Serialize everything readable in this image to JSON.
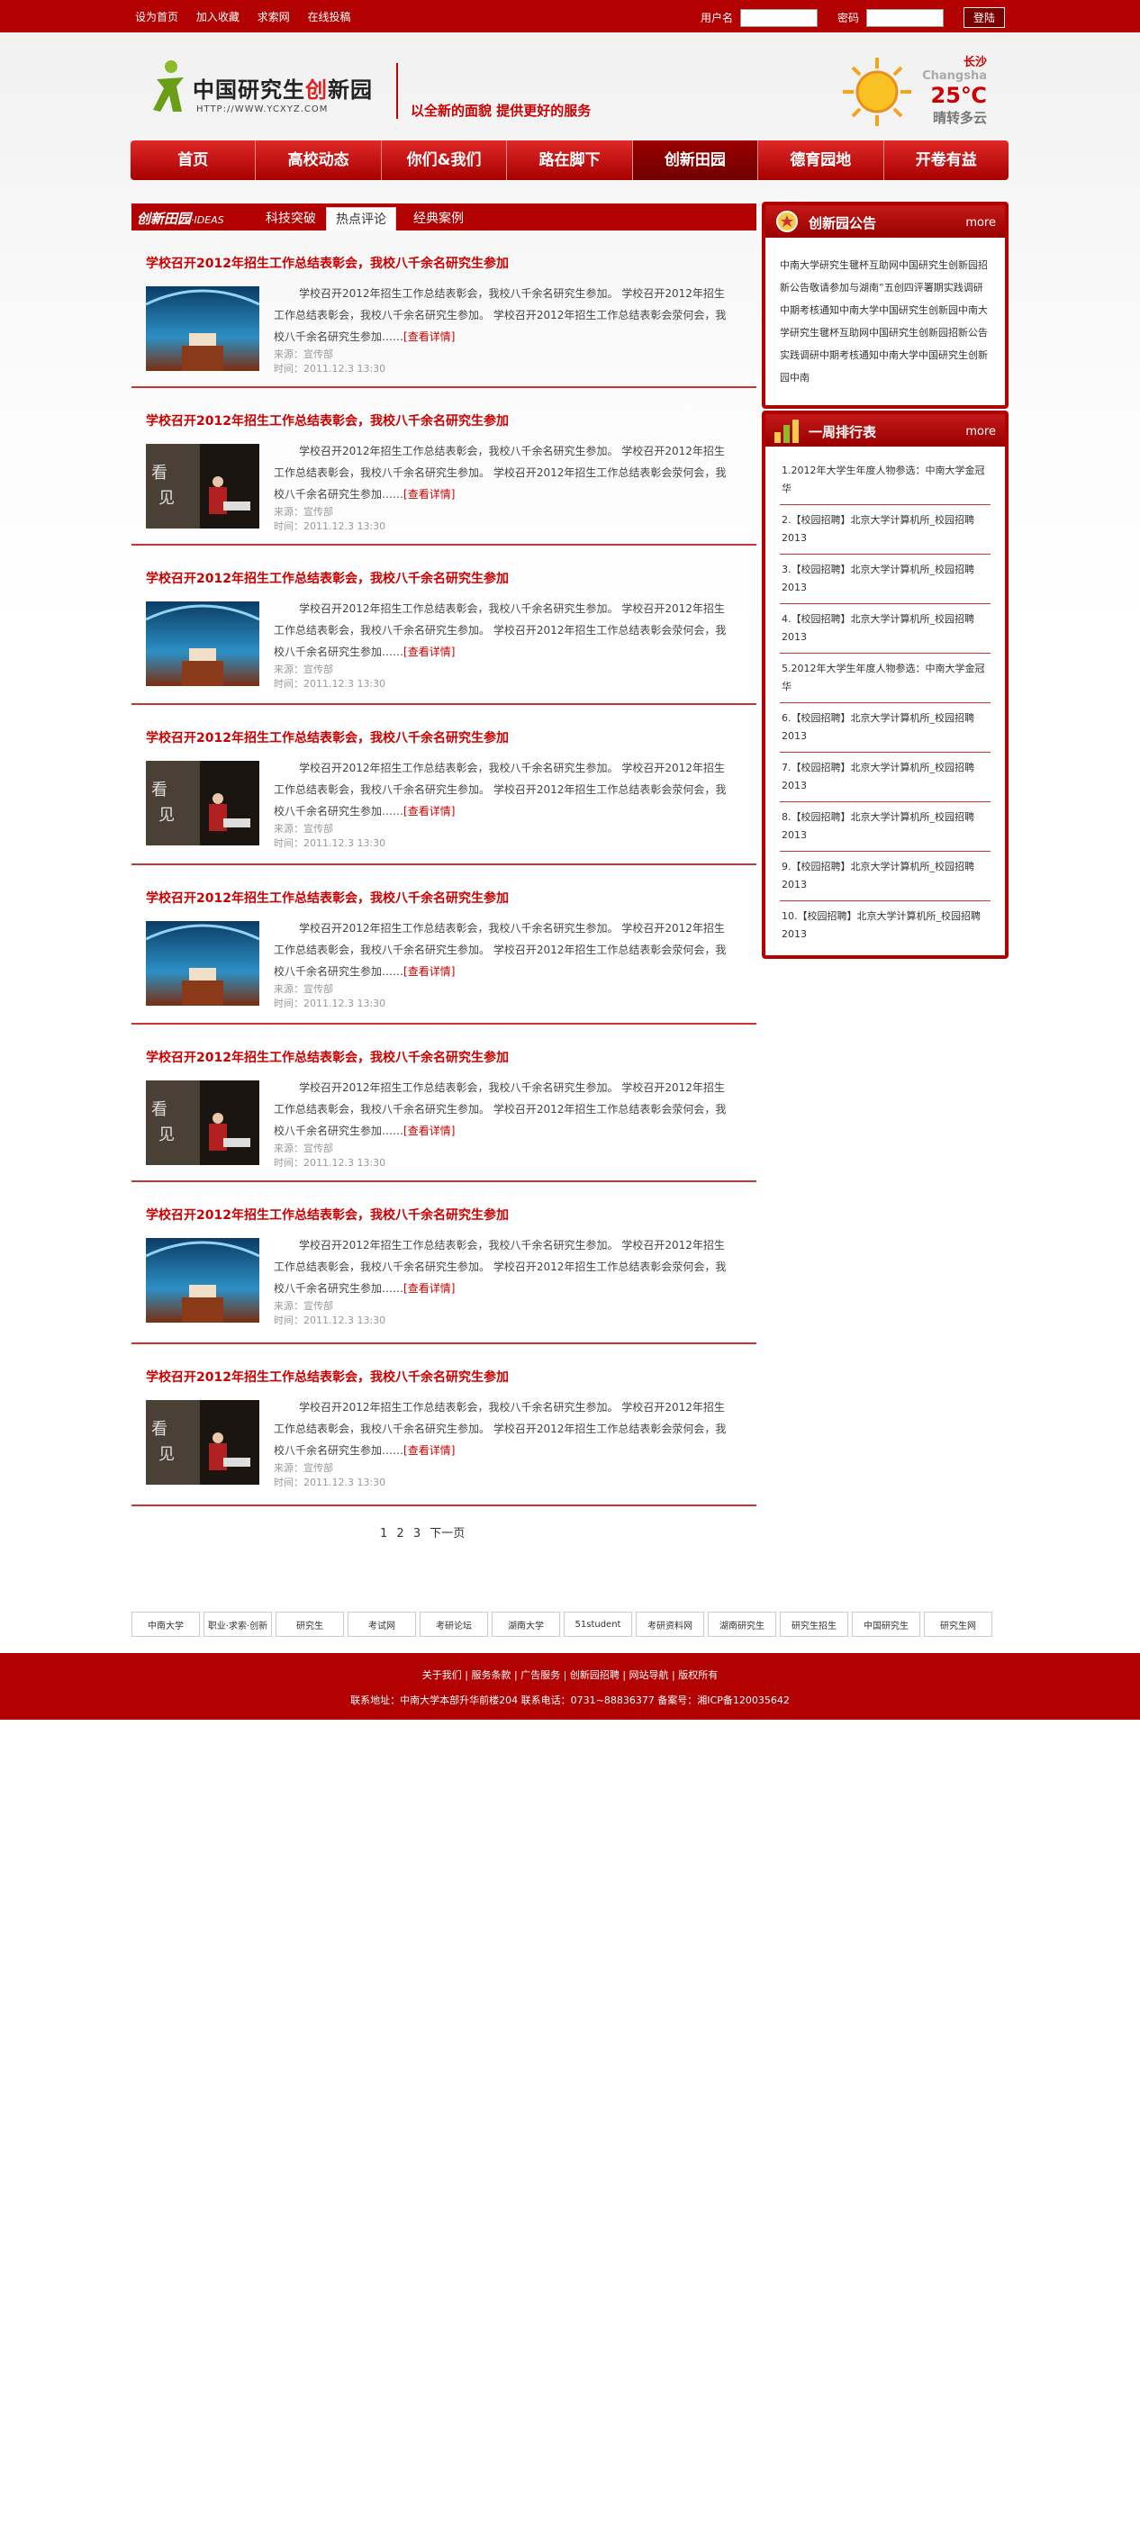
{
  "topbar": {
    "links": [
      "设为首页",
      "加入收藏",
      "求索网",
      "在线投稿"
    ],
    "username_label": "用户名",
    "password_label": "密码",
    "login_button": "登陆"
  },
  "logo": {
    "text_a": "中国研究生",
    "text_b": "创",
    "text_c": "新园",
    "url": "HTTP://WWW.YCXYZ.COM"
  },
  "slogan": "以全新的面貌 提供更好的服务",
  "weather": {
    "city": "长沙",
    "pinyin": "Changsha",
    "temp": "25℃",
    "desc": "晴转多云"
  },
  "nav": [
    "首页",
    "高校动态",
    "你们&我们",
    "路在脚下",
    "创新田园",
    "德育园地",
    "开卷有益"
  ],
  "section": {
    "title": "创新田园",
    "title_en": "IDEAS",
    "tabs": [
      "科技突破",
      "热点评论",
      "经典案例"
    ]
  },
  "articles": [
    {
      "title": "学校召开2012年招生工作总结表彰会，我校八千余名研究生参加",
      "body": "学校召开2012年招生工作总结表彰会，我校八千余名研究生参加。 学校召开2012年招生工作总结表彰会，我校八千余名研究生参加。 学校召开2012年招生工作总结表彰会荥何会，我校八千余名研究生参加……",
      "more": "[查看详情]",
      "source": "来源：宣传部",
      "time": "时间：2011.12.3  13:30",
      "img": "aquarium"
    },
    {
      "title": "学校召开2012年招生工作总结表彰会，我校八千余名研究生参加",
      "body": "学校召开2012年招生工作总结表彰会，我校八千余名研究生参加。 学校召开2012年招生工作总结表彰会，我校八千余名研究生参加。 学校召开2012年招生工作总结表彰会荥何会，我校八千余名研究生参加……",
      "more": "[查看详情]",
      "source": "来源：宣传部",
      "time": "时间：2011.12.3  13:30",
      "img": "kanjian"
    },
    {
      "title": "学校召开2012年招生工作总结表彰会，我校八千余名研究生参加",
      "body": "学校召开2012年招生工作总结表彰会，我校八千余名研究生参加。 学校召开2012年招生工作总结表彰会，我校八千余名研究生参加。 学校召开2012年招生工作总结表彰会荥何会，我校八千余名研究生参加……",
      "more": "[查看详情]",
      "source": "来源：宣传部",
      "time": "时间：2011.12.3  13:30",
      "img": "aquarium"
    },
    {
      "title": "学校召开2012年招生工作总结表彰会，我校八千余名研究生参加",
      "body": "学校召开2012年招生工作总结表彰会，我校八千余名研究生参加。 学校召开2012年招生工作总结表彰会，我校八千余名研究生参加。 学校召开2012年招生工作总结表彰会荥何会，我校八千余名研究生参加……",
      "more": "[查看详情]",
      "source": "来源：宣传部",
      "time": "时间：2011.12.3  13:30",
      "img": "kanjian"
    },
    {
      "title": "学校召开2012年招生工作总结表彰会，我校八千余名研究生参加",
      "body": "学校召开2012年招生工作总结表彰会，我校八千余名研究生参加。 学校召开2012年招生工作总结表彰会，我校八千余名研究生参加。 学校召开2012年招生工作总结表彰会荥何会，我校八千余名研究生参加……",
      "more": "[查看详情]",
      "source": "来源：宣传部",
      "time": "时间：2011.12.3  13:30",
      "img": "aquarium"
    },
    {
      "title": "学校召开2012年招生工作总结表彰会，我校八千余名研究生参加",
      "body": "学校召开2012年招生工作总结表彰会，我校八千余名研究生参加。 学校召开2012年招生工作总结表彰会，我校八千余名研究生参加。 学校召开2012年招生工作总结表彰会荥何会，我校八千余名研究生参加……",
      "more": "[查看详情]",
      "source": "来源：宣传部",
      "time": "时间：2011.12.3  13:30",
      "img": "kanjian"
    },
    {
      "title": "学校召开2012年招生工作总结表彰会，我校八千余名研究生参加",
      "body": "学校召开2012年招生工作总结表彰会，我校八千余名研究生参加。 学校召开2012年招生工作总结表彰会，我校八千余名研究生参加。 学校召开2012年招生工作总结表彰会荥何会，我校八千余名研究生参加……",
      "more": "[查看详情]",
      "source": "来源：宣传部",
      "time": "时间：2011.12.3  13:30",
      "img": "aquarium"
    },
    {
      "title": "学校召开2012年招生工作总结表彰会，我校八千余名研究生参加",
      "body": "学校召开2012年招生工作总结表彰会，我校八千余名研究生参加。 学校召开2012年招生工作总结表彰会，我校八千余名研究生参加。 学校召开2012年招生工作总结表彰会荥何会，我校八千余名研究生参加……",
      "more": "[查看详情]",
      "source": "来源：宣传部",
      "time": "时间：2011.12.3  13:30",
      "img": "kanjian"
    }
  ],
  "pager": [
    "1",
    "2",
    "3",
    "下一页"
  ],
  "notice": {
    "title": "创新园公告",
    "more": "more",
    "text": "中南大学研究生毽杯互助网中国研究生创新园招新公告敬请参加与湖南”五创四评署期实践调研中期考核通知中南大学中国研究生创新园中南大学研究生毽杯互助网中国研究生创新园招新公告实践调研中期考核通知中南大学中国研究生创新园中南"
  },
  "ranking": {
    "title": "一周排行表",
    "more": "more",
    "items": [
      "1.2012年大学生年度人物参选：中南大学金冠华",
      "2.【校园招聘】北京大学计算机所_校园招聘2013",
      "3.【校园招聘】北京大学计算机所_校园招聘2013",
      "4.【校园招聘】北京大学计算机所_校园招聘2013",
      "5.2012年大学生年度人物参选：中南大学金冠华",
      "6.【校园招聘】北京大学计算机所_校园招聘2013",
      "7.【校园招聘】北京大学计算机所_校园招聘2013",
      "8.【校园招聘】北京大学计算机所_校园招聘2013",
      "9.【校园招聘】北京大学计算机所_校园招聘2013",
      "10.【校园招聘】北京大学计算机所_校园招聘2013"
    ]
  },
  "partners": [
    "中南大学",
    "职业·求索·创新",
    "研究生",
    "考试网",
    "考研论坛",
    "湖南大学",
    "51student",
    "考研资料网",
    "湖南研究生",
    "研究生招生",
    "中国研究生",
    "研究生网"
  ],
  "footer": {
    "links": "关于我们 | 服务条款 | 广告服务 | 创新园招聘 | 网站导航 | 版权所有",
    "address": "联系地址：中南大学本部升华前楼204 联系电话：0731~88836377 备案号：湘ICP备120035642"
  },
  "kanjian_text": "看见",
  "colors": {
    "brand": "#b30000",
    "accent": "#cc0000"
  }
}
